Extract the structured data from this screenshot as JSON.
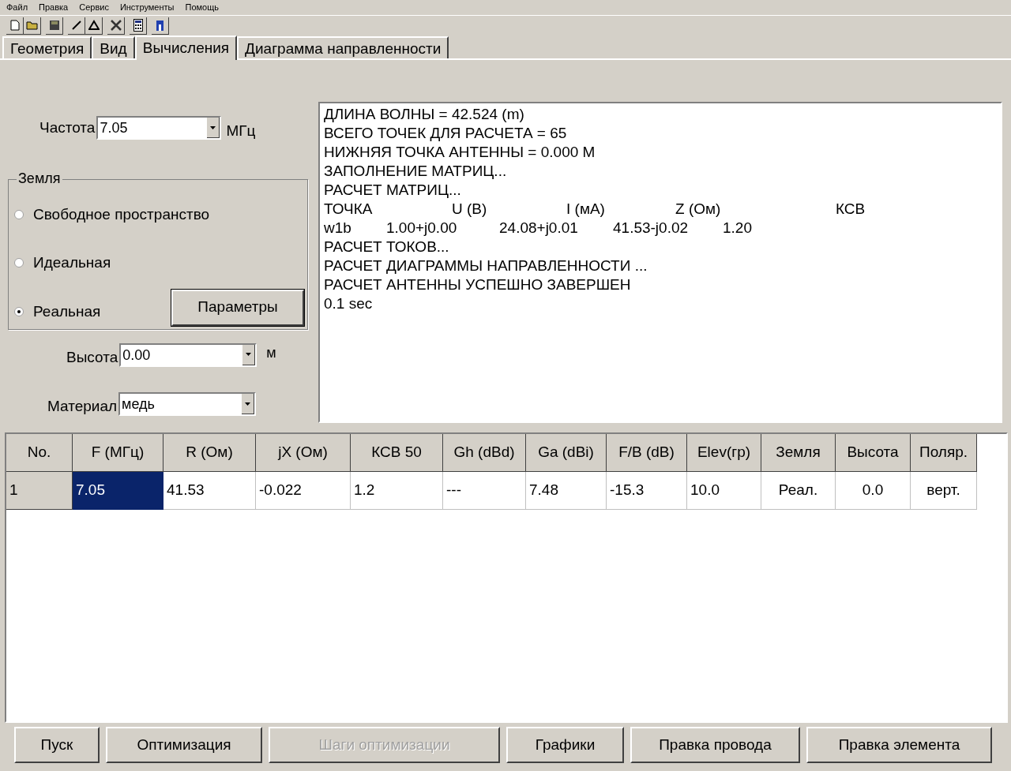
{
  "menu": [
    "Файл",
    "Правка",
    "Сервис",
    "Инструменты",
    "Помощь"
  ],
  "tabs": [
    {
      "label": "Геометрия",
      "selected": false
    },
    {
      "label": "Вид",
      "selected": false
    },
    {
      "label": "Вычисления",
      "selected": true
    },
    {
      "label": "Диаграмма направленности",
      "selected": false
    }
  ],
  "frequency": {
    "label": "Частота",
    "value": "7.05",
    "unit": "МГц"
  },
  "ground": {
    "title": "Земля",
    "options": [
      {
        "label": "Свободное пространство",
        "selected": false
      },
      {
        "label": "Идеальная",
        "selected": false
      },
      {
        "label": "Реальная",
        "selected": true
      }
    ],
    "params_button": "Параметры"
  },
  "height": {
    "label": "Высота",
    "value": "0.00",
    "unit": "м"
  },
  "material": {
    "label": "Материал",
    "value": "медь"
  },
  "log": [
    {
      "kind": "text",
      "text": "ДЛИНА ВОЛНЫ = 42.524 (m)"
    },
    {
      "kind": "text",
      "text": "ВСЕГО ТОЧЕК ДЛЯ РАСЧЕТА = 65"
    },
    {
      "kind": "text",
      "text": "НИЖНЯЯ ТОЧКА АНТЕННЫ = 0.000 М"
    },
    {
      "kind": "text",
      "text": "ЗАПОЛНЕНИЕ МАТРИЦ..."
    },
    {
      "kind": "text",
      "text": "РАСЧЕТ МАТРИЦ..."
    },
    {
      "kind": "header",
      "cells": [
        "ТОЧКА",
        "U (В)",
        "I (мА)",
        "Z (Ом)",
        "КСВ"
      ]
    },
    {
      "kind": "values",
      "cells": [
        "w1b",
        "1.00+j0.00",
        "24.08+j0.01",
        "41.53-j0.02",
        "1.20"
      ]
    },
    {
      "kind": "text",
      "text": "РАСЧЕТ ТОКОВ..."
    },
    {
      "kind": "text",
      "text": "РАСЧЕТ ДИАГРАММЫ НАПРАВЛЕННОСТИ ..."
    },
    {
      "kind": "text",
      "text": "РАСЧЕТ АНТЕННЫ УСПЕШНО ЗАВЕРШЕН"
    },
    {
      "kind": "text",
      "text": "0.1 sec"
    }
  ],
  "table": {
    "columns": [
      "No.",
      "F (МГц)",
      "R (Ом)",
      "jX (Ом)",
      "КСВ 50",
      "Gh (dBd)",
      "Ga (dBi)",
      "F/B (dB)",
      "Elev(гр)",
      "Земля",
      "Высота",
      "Поляр."
    ],
    "rows": [
      {
        "cells": [
          {
            "text": "1",
            "selected": false
          },
          {
            "text": "7.05",
            "selected": true
          },
          {
            "text": "41.53",
            "selected": false
          },
          {
            "text": "-0.022",
            "selected": false
          },
          {
            "text": "1.2",
            "selected": false
          },
          {
            "text": "---",
            "selected": false
          },
          {
            "text": "7.48",
            "selected": false
          },
          {
            "text": "-15.3",
            "selected": false
          },
          {
            "text": "10.0",
            "selected": false
          },
          {
            "text": "Реал.",
            "selected": false
          },
          {
            "text": "0.0",
            "selected": false
          },
          {
            "text": "верт.",
            "selected": false
          }
        ]
      }
    ]
  },
  "buttons": [
    {
      "label": "Пуск",
      "disabled": false
    },
    {
      "label": "Оптимизация",
      "disabled": false
    },
    {
      "label": "Шаги оптимизации",
      "disabled": true
    },
    {
      "label": "Графики",
      "disabled": false
    },
    {
      "label": "Правка провода",
      "disabled": false
    },
    {
      "label": "Правка элемента",
      "disabled": false
    }
  ]
}
